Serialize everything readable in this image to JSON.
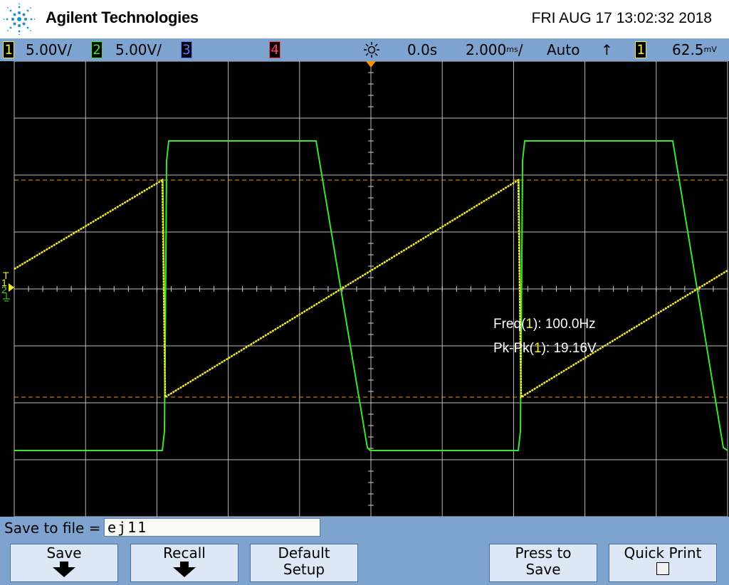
{
  "header": {
    "brand": "Agilent Technologies",
    "datetime": "FRI AUG 17 13:02:32 2018"
  },
  "status": {
    "ch1_num": "1",
    "ch1_scale": "5.00V/",
    "ch2_num": "2",
    "ch2_scale": "5.00V/",
    "ch3_num": "3",
    "ch4_num": "4",
    "delay": "0.0s",
    "timebase": "2.000",
    "timebase_unit": "ms",
    "timebase_suffix": "/",
    "trigger_mode": "Auto",
    "trigger_slope": "↑",
    "trigger_source": "1",
    "trigger_level": "62.5",
    "trigger_level_unit": "mV"
  },
  "markers": {
    "trigger": "T",
    "ch1": "1",
    "ch2": "2"
  },
  "measurements": {
    "freq_label": "Freq(",
    "freq_ch": "1",
    "freq_close": "): 100.0Hz",
    "pkpk_label": "Pk-Pk(",
    "pkpk_ch": "1",
    "pkpk_close": "): 19.16V"
  },
  "colors": {
    "ch1": "#f4ee2a",
    "ch2": "#39e62d",
    "ch3": "#4a7cff",
    "ch4": "#ff3b6b",
    "cursor": "#ff8c00",
    "grid": "#ffffff"
  },
  "save": {
    "label": "Save to file =",
    "filename": "ej11"
  },
  "softkeys": [
    {
      "line1": "Save",
      "line2": ""
    },
    {
      "line1": "Recall",
      "line2": ""
    },
    {
      "line1": "Default",
      "line2": "Setup"
    },
    {
      "line1": "Press to",
      "line2": "Save"
    },
    {
      "line1": "Quick Print",
      "line2": ""
    }
  ]
}
